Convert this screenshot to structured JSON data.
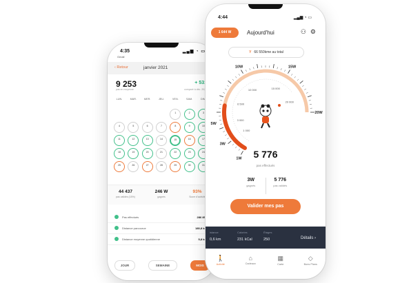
{
  "left_phone": {
    "status": {
      "time": "4:35",
      "carrier": "Gmail"
    },
    "header": {
      "back_label": "Retour",
      "month": "janvier 2021"
    },
    "summary": {
      "steps": "9 253",
      "steps_caption": "pas en moyenne",
      "delta": "+ 531",
      "delta_caption": "comparé à déc. 2020"
    },
    "weekdays": [
      "LUN.",
      "MAR.",
      "MER.",
      "JEU.",
      "VEN.",
      "SAM.",
      "DIM."
    ],
    "calendar_rows": [
      [
        {
          "t": "",
          "c": "empty"
        },
        {
          "t": "",
          "c": "empty"
        },
        {
          "t": "",
          "c": "empty"
        },
        {
          "t": "",
          "c": "empty"
        },
        {
          "t": "1",
          "c": "l"
        },
        {
          "t": "2",
          "c": "g"
        },
        {
          "t": "3",
          "c": "g"
        }
      ],
      [
        {
          "t": "4",
          "c": "l"
        },
        {
          "t": "5",
          "c": "l"
        },
        {
          "t": "6",
          "c": "l"
        },
        {
          "t": "7",
          "c": "l"
        },
        {
          "t": "8",
          "c": "o"
        },
        {
          "t": "9",
          "c": "g"
        },
        {
          "t": "10",
          "c": "g"
        }
      ],
      [
        {
          "t": "11",
          "c": "g"
        },
        {
          "t": "12",
          "c": "g"
        },
        {
          "t": "13",
          "c": "g"
        },
        {
          "t": "14",
          "c": "l"
        },
        {
          "t": "15",
          "c": "f"
        },
        {
          "t": "16",
          "c": "o"
        },
        {
          "t": "17",
          "c": "g"
        }
      ],
      [
        {
          "t": "18",
          "c": "g"
        },
        {
          "t": "19",
          "c": "g"
        },
        {
          "t": "20",
          "c": "g"
        },
        {
          "t": "21",
          "c": "l"
        },
        {
          "t": "22",
          "c": "g"
        },
        {
          "t": "23",
          "c": "g"
        },
        {
          "t": "24",
          "c": "g"
        }
      ],
      [
        {
          "t": "25",
          "c": "o"
        },
        {
          "t": "26",
          "c": "l"
        },
        {
          "t": "27",
          "c": "o"
        },
        {
          "t": "28",
          "c": "l"
        },
        {
          "t": "29",
          "c": "o"
        },
        {
          "t": "30",
          "c": "g"
        },
        {
          "t": "31",
          "c": "g"
        }
      ]
    ],
    "stats": [
      {
        "value": "44 437",
        "label": "pas validés (15%)",
        "accent": false
      },
      {
        "value": "246 W",
        "label": "gagnés",
        "accent": false
      },
      {
        "value": "93%",
        "label": "Score d'activité",
        "accent": true
      }
    ],
    "rows": [
      {
        "label": "Pas effectués",
        "value": "286 852"
      },
      {
        "label": "Distance parcourue",
        "value": "180,8 km"
      },
      {
        "label": "Distance moyenne quotidienne",
        "value": "5,8 km"
      }
    ],
    "segments": {
      "day": "JOUR",
      "week": "SEMAINE",
      "month": "MOIS"
    }
  },
  "right_phone": {
    "status": {
      "time": "4:44"
    },
    "header": {
      "coins": "1 644 W",
      "title": "Aujourd'hui"
    },
    "total_pill": {
      "icon": "Y",
      "text": "66 550kme au total"
    },
    "gauge": {
      "labels": [
        "5W",
        "10W",
        "15W",
        "20W",
        "3W",
        "1W"
      ],
      "inner_labels": [
        "1 000",
        "3 000",
        "6 500",
        "10 000",
        "15 000",
        "20 000"
      ],
      "progress": 0.2888
    },
    "steps": "5 776",
    "steps_caption": "pas effectués",
    "earned": {
      "earned_value": "3W",
      "earned_label": "gagnés",
      "validated_value": "5 776",
      "validated_label": "pas validés"
    },
    "validate_button": "Valider mes pas",
    "dark_bar": {
      "distance_label": "istance",
      "distance_value": "0,6 km",
      "calories_label": "Calories",
      "calories_value": "231 kCal",
      "floors_label": "Étages",
      "floors_value": "250",
      "details": "Détails"
    },
    "tabs": [
      {
        "label": "Activité",
        "icon": "walk-icon"
      },
      {
        "label": "Cadeaux",
        "icon": "gift-icon"
      },
      {
        "label": "Carte",
        "icon": "map-icon"
      },
      {
        "label": "Bons Plans",
        "icon": "tag-icon"
      }
    ],
    "colors": {
      "accent": "#ee7a3a",
      "green": "#41c08a",
      "dark": "#2a3140"
    }
  }
}
